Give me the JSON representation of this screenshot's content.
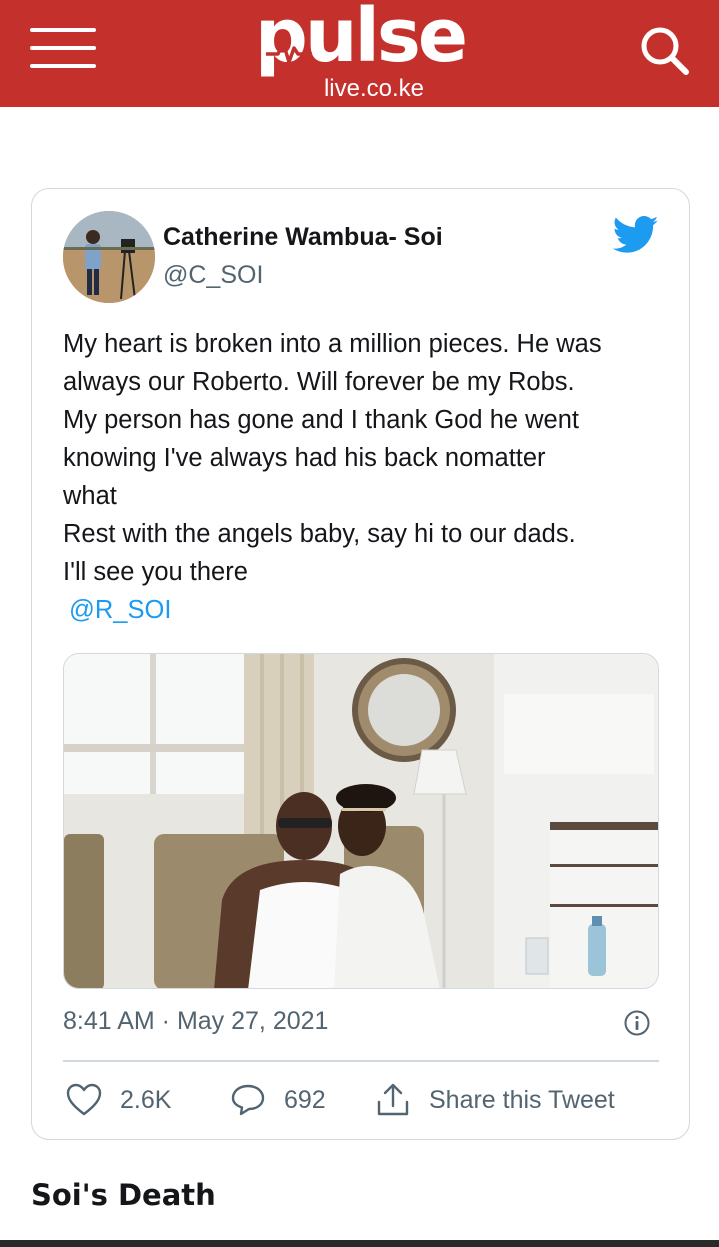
{
  "header": {
    "logo_text": "pulse",
    "logo_domain": "live.co.ke",
    "brand_color": "#c4302b",
    "menu_icon": "hamburger-menu-icon",
    "search_icon": "search-icon"
  },
  "tweet": {
    "author_name": "Catherine Wambua- Soi",
    "author_handle": "@C_SOI",
    "text_lines": [
      "My heart is broken into a million pieces. He was",
      "always our Roberto. Will forever be my Robs.",
      "My person has gone and I thank God he went",
      "knowing I've always had his back nomatter",
      "what",
      "Rest with the angels baby, say hi to our dads.",
      "I'll see you there"
    ],
    "mention": "@R_SOI",
    "timestamp": "8:41 AM · May 27, 2021",
    "likes": "2.6K",
    "replies": "692",
    "share_label": "Share this Tweet",
    "twitter_color": "#1d9bf0"
  },
  "article": {
    "section_heading": "Soi's Death"
  }
}
